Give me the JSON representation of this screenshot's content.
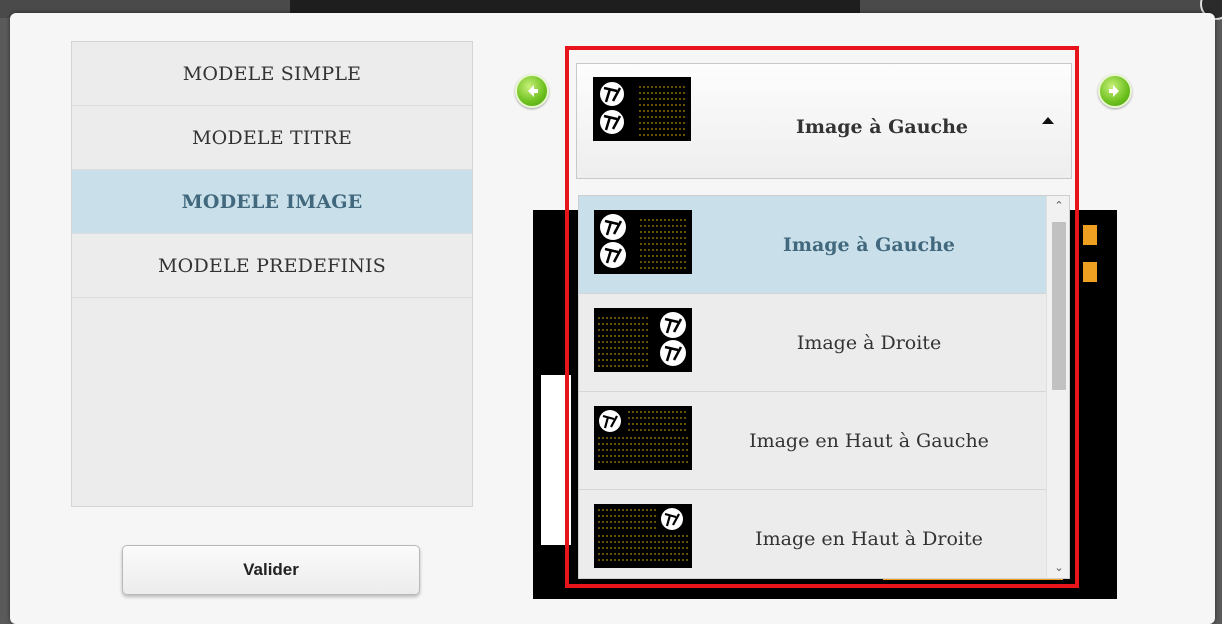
{
  "menu": {
    "items": [
      {
        "label": "MODELE SIMPLE",
        "active": false
      },
      {
        "label": "MODELE TITRE",
        "active": false
      },
      {
        "label": "MODELE IMAGE",
        "active": true
      },
      {
        "label": "MODELE PREDEFINIS",
        "active": false
      }
    ]
  },
  "actions": {
    "validate_label": "Valider"
  },
  "select": {
    "selected_label": "Image à Gauche",
    "selected_icon": "image-left-thumbnail-icon",
    "options": [
      {
        "label": "Image à Gauche",
        "icon": "image-left-thumbnail-icon",
        "selected": true
      },
      {
        "label": "Image à Droite",
        "icon": "image-right-thumbnail-icon",
        "selected": false
      },
      {
        "label": "Image en Haut à Gauche",
        "icon": "image-top-left-thumbnail-icon",
        "selected": false
      },
      {
        "label": "Image en Haut à Droite",
        "icon": "image-top-right-thumbnail-icon",
        "selected": false
      }
    ]
  },
  "colors": {
    "active_bg": "#c9e0ea",
    "active_text": "#41687d",
    "highlight_border": "#e8141b",
    "arrow_green": "#6cc01d",
    "thumb_dots": "#c8a400"
  }
}
